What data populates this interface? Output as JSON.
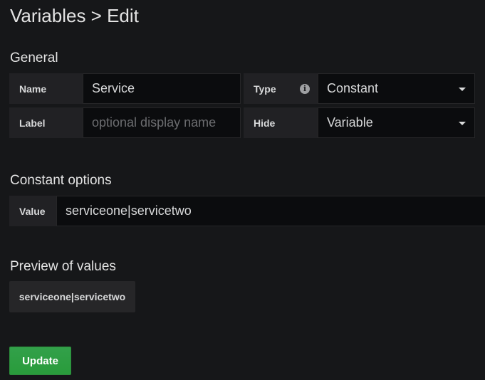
{
  "header": {
    "title": "Variables > Edit"
  },
  "general": {
    "section_title": "General",
    "name_label": "Name",
    "name_value": "Service",
    "type_label": "Type",
    "type_value": "Constant",
    "label_label": "Label",
    "label_placeholder": "optional display name",
    "hide_label": "Hide",
    "hide_value": "Variable",
    "info_icon_glyph": "i"
  },
  "constant_options": {
    "section_title": "Constant options",
    "value_label": "Value",
    "value": "serviceone|servicetwo"
  },
  "preview": {
    "section_title": "Preview of values",
    "values": [
      "serviceone|servicetwo"
    ]
  },
  "actions": {
    "update_label": "Update"
  },
  "colors": {
    "background": "#161719",
    "label_bg": "#212124",
    "input_bg": "#0b0c0e",
    "button_green": "#299c3b"
  }
}
